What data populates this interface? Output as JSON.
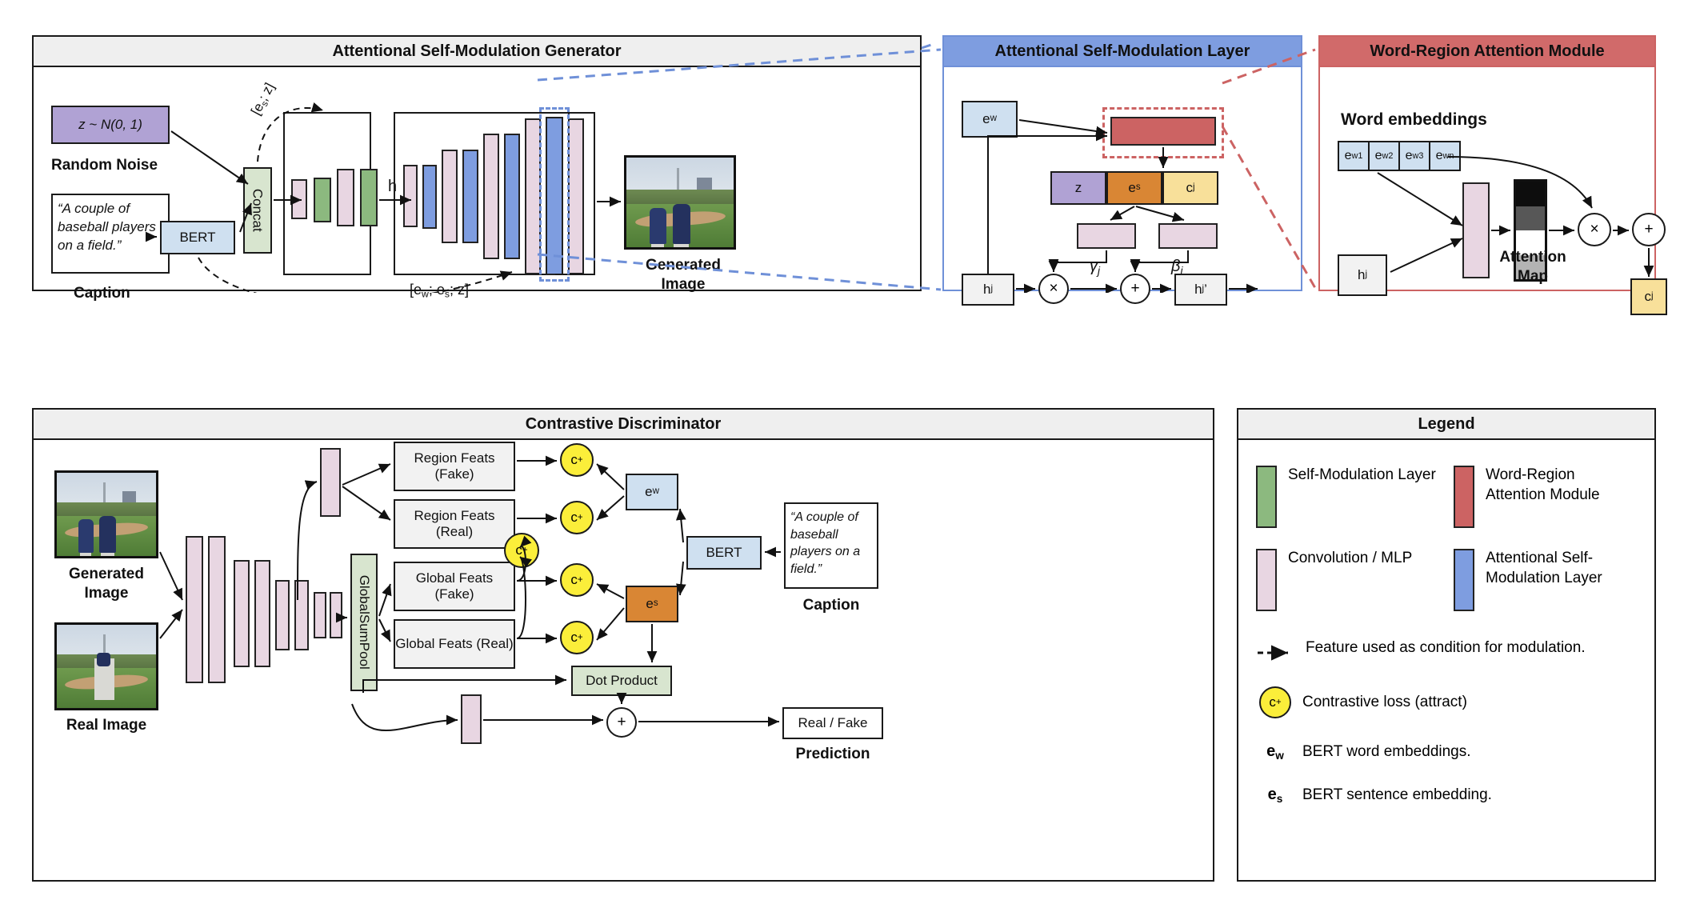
{
  "panels": {
    "generator": {
      "title": "Attentional Self-Modulation Generator"
    },
    "asm_layer": {
      "title": "Attentional Self-Modulation Layer"
    },
    "wram": {
      "title": "Word-Region Attention Module"
    },
    "discriminator": {
      "title": "Contrastive Discriminator"
    },
    "legend": {
      "title": "Legend"
    }
  },
  "generator": {
    "noise_box": "z ~ N(0, 1)",
    "noise_label": "Random Noise",
    "caption_text": "“A couple of baseball players on a field.”",
    "caption_label": "Caption",
    "bert": "BERT",
    "es_edge": "e",
    "es_sub": "s",
    "concat": "Concat",
    "h_label": "h",
    "cond_top": "[e",
    "cond_top_sub": "s",
    "cond_top_rest": "; z]",
    "cond_bottom_1": "[e",
    "cond_bottom_sub1": "w",
    "cond_bottom_2": "; e",
    "cond_bottom_sub2": "s",
    "cond_bottom_3": "; z]",
    "generated_label": "Generated Image"
  },
  "asm_layer": {
    "ew": "e",
    "ew_sub": "w",
    "z": "z",
    "es": "e",
    "es_sub": "s",
    "cj": "c",
    "cj_sub": "j",
    "gamma": "γ",
    "gamma_sub": "j",
    "beta": "β",
    "beta_sub": "j",
    "hj": "h",
    "hj_sub": "j",
    "hj_out": "h",
    "hj_out_sub": "j",
    "hj_out_prime": "’",
    "multiply": "×",
    "add": "+"
  },
  "wram": {
    "word_embeddings_label": "Word embeddings",
    "word_cells": [
      {
        "base": "e",
        "sub": "w1"
      },
      {
        "base": "e",
        "sub": "w2"
      },
      {
        "base": "e",
        "sub": "w3"
      },
      {
        "base": "e",
        "sub": "wn"
      }
    ],
    "hj": "h",
    "hj_sub": "j",
    "attention_map_label": "Attention Map",
    "multiply": "×",
    "add": "+",
    "cj": "c",
    "cj_sub": "j",
    "attention_map_shades": [
      "#0d0d0d",
      "#575757",
      "#ffffff",
      "#b3b3b3"
    ]
  },
  "discriminator": {
    "generated_image_label": "Generated Image",
    "real_image_label": "Real Image",
    "globalsumpool": "GlobalSumPool",
    "region_feats_fake": "Region Feats (Fake)",
    "region_feats_real": "Region Feats (Real)",
    "global_feats_fake": "Global Feats (Fake)",
    "global_feats_real": "Global Feats (Real)",
    "ew": "e",
    "ew_sub": "w",
    "es": "e",
    "es_sub": "s",
    "bert": "BERT",
    "caption_text": "“A couple of baseball players on a field.”",
    "caption_label": "Caption",
    "dot_product": "Dot Product",
    "add": "+",
    "real_fake": "Real / Fake",
    "prediction_label": "Prediction",
    "cplus": "c",
    "cplus_sup": "+"
  },
  "legend": {
    "items": [
      {
        "swatch": "#8cb97f",
        "label": "Self-Modulation Layer"
      },
      {
        "swatch": "#cc6363",
        "label": "Word-Region Attention Module"
      },
      {
        "swatch": "#e8d6e2",
        "label": "Convolution / MLP"
      },
      {
        "swatch": "#7e9de0",
        "label": "Attentional Self-Modulation Layer"
      }
    ],
    "dashed_label": "Feature used as condition for modulation.",
    "cplus_label": "Contrastive loss (attract)",
    "cplus": "c",
    "cplus_sup": "+",
    "ew_label": "BERT word embeddings.",
    "ew": "e",
    "ew_sub": "w",
    "es_label": "BERT sentence embedding.",
    "es": "e",
    "es_sub": "s"
  },
  "colors": {
    "self_modulation": "#8cb97f",
    "convolution_mlp": "#e8d6e2",
    "word_region_attention": "#cc6363",
    "attentional_self_modulation": "#7e9de0",
    "noise": "#b0a2d4",
    "sentence_embedding": "#d98634",
    "context": "#f8e09a",
    "bert": "#cfe0f0",
    "contrastive": "#fbee3a"
  }
}
